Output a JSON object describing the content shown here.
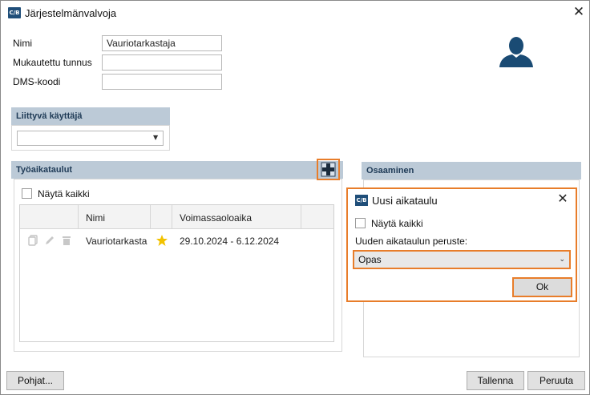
{
  "window": {
    "title": "Järjestelmänvalvoja",
    "icon_text": "C/B"
  },
  "form": {
    "name_label": "Nimi",
    "name_value": "Vauriotarkastaja",
    "custom_id_label": "Mukautettu tunnus",
    "custom_id_value": "",
    "dms_label": "DMS-koodi",
    "dms_value": ""
  },
  "linked_user": {
    "header": "Liittyvä käyttäjä",
    "selected": ""
  },
  "schedules": {
    "header": "Työaikataulut",
    "show_all_label": "Näytä kaikki",
    "columns": [
      "",
      "Nimi",
      "",
      "Voimassaoloaika",
      ""
    ],
    "rows": [
      {
        "name": "Vauriotarkasta",
        "validity": "29.10.2024 - 6.12.2024",
        "favorite": true
      }
    ]
  },
  "skills": {
    "header": "Osaaminen"
  },
  "dialog": {
    "title": "Uusi aikataulu",
    "icon_text": "C/B",
    "show_all_label": "Näytä kaikki",
    "basis_label": "Uuden aikataulun peruste:",
    "basis_value": "Opas",
    "ok_label": "Ok"
  },
  "footer": {
    "templates_label": "Pohjat...",
    "save_label": "Tallenna",
    "cancel_label": "Peruuta"
  },
  "colors": {
    "accent_highlight": "#e87d2a",
    "section_header": "#bccad7",
    "star": "#f2c200",
    "icon_blue": "#1f4e79"
  }
}
